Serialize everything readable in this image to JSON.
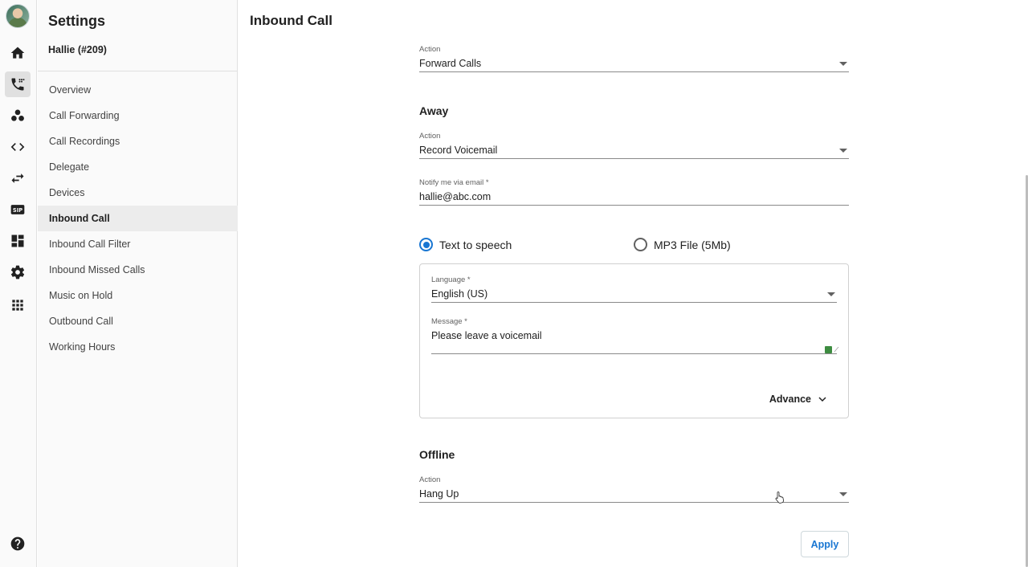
{
  "rail": {
    "items": [
      {
        "icon": "home-icon"
      },
      {
        "icon": "phone-icon",
        "active": true
      },
      {
        "icon": "contacts-icon"
      },
      {
        "icon": "code-icon"
      },
      {
        "icon": "transfer-icon"
      },
      {
        "icon": "sip-icon"
      },
      {
        "icon": "dashboard-icon"
      },
      {
        "icon": "gear-icon"
      },
      {
        "icon": "apps-grid-icon"
      }
    ],
    "help_icon": "help-icon"
  },
  "sidebar": {
    "title": "Settings",
    "user": "Hallie (#209)",
    "items": [
      {
        "label": "Overview"
      },
      {
        "label": "Call Forwarding"
      },
      {
        "label": "Call Recordings"
      },
      {
        "label": "Delegate"
      },
      {
        "label": "Devices"
      },
      {
        "label": "Inbound Call",
        "active": true
      },
      {
        "label": "Inbound Call Filter"
      },
      {
        "label": "Inbound Missed Calls"
      },
      {
        "label": "Music on Hold"
      },
      {
        "label": "Outbound Call"
      },
      {
        "label": "Working Hours"
      }
    ]
  },
  "main": {
    "title": "Inbound Call",
    "top_action": {
      "label": "Action",
      "value": "Forward Calls"
    },
    "away": {
      "heading": "Away",
      "action": {
        "label": "Action",
        "value": "Record Voicemail"
      },
      "email": {
        "label": "Notify me via email *",
        "value": "hallie@abc.com"
      },
      "radio_tts": {
        "label": "Text to speech",
        "selected": true
      },
      "radio_mp3": {
        "label": "MP3 File (5Mb)",
        "selected": false
      },
      "language": {
        "label": "Language *",
        "value": "English (US)"
      },
      "message": {
        "label": "Message *",
        "value": "Please leave a voicemail"
      },
      "advance": "Advance"
    },
    "offline": {
      "heading": "Offline",
      "action": {
        "label": "Action",
        "value": "Hang Up"
      }
    },
    "apply": "Apply",
    "accent": "#1976d2"
  }
}
